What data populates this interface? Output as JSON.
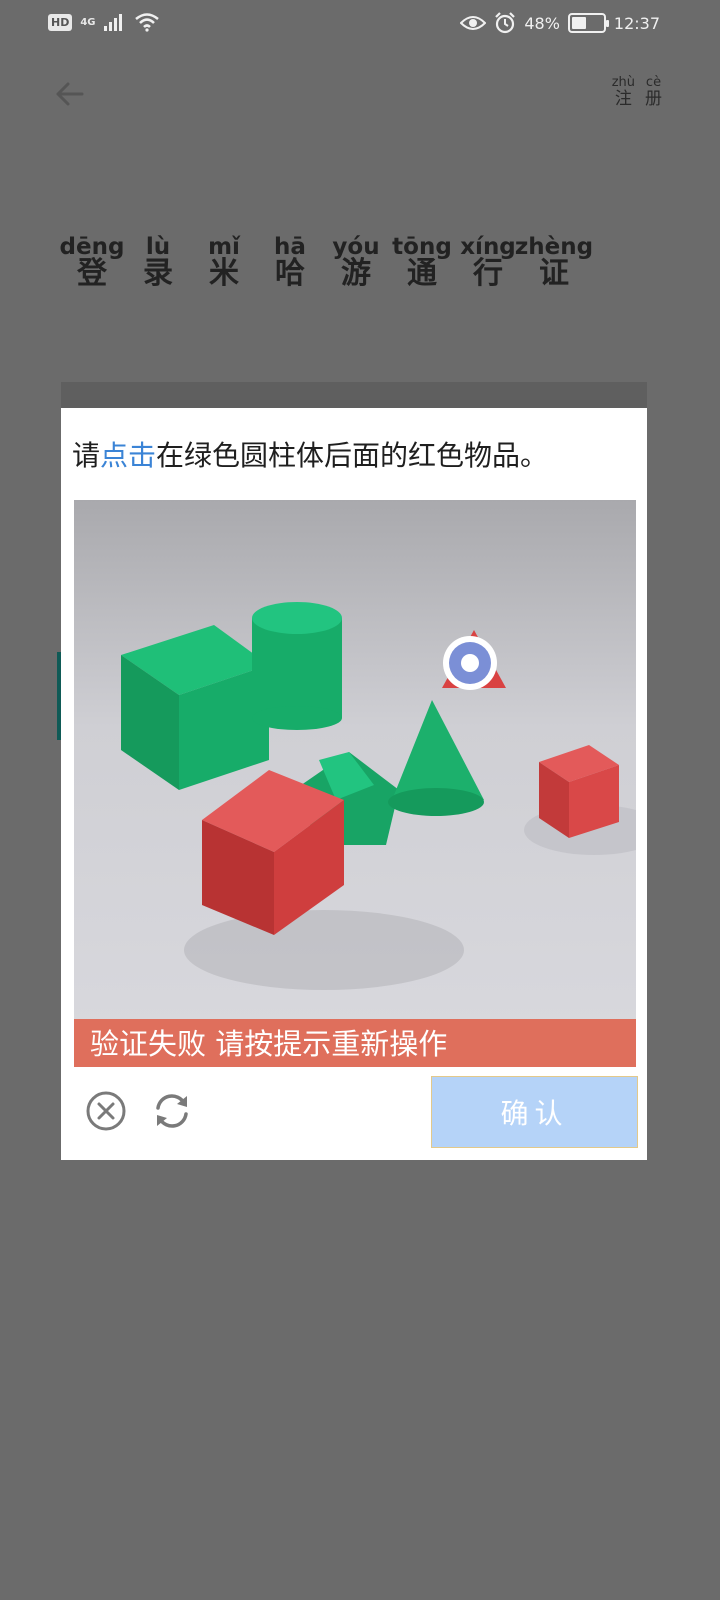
{
  "status_bar": {
    "hd_badge": "HD",
    "network": "4G",
    "icons": [
      "signal-icon",
      "wifi-icon",
      "eye-icon",
      "alarm-icon"
    ],
    "battery_percent": "48%",
    "battery_level": 0.48,
    "time": "12:37"
  },
  "header": {
    "back_icon": "arrow-left-icon",
    "register": [
      {
        "pinyin": "zhù",
        "hanzi": "注"
      },
      {
        "pinyin": "cè",
        "hanzi": "册"
      }
    ]
  },
  "title": [
    {
      "pinyin": "dēng",
      "hanzi": "登"
    },
    {
      "pinyin": "lù",
      "hanzi": "录"
    },
    {
      "pinyin": "mǐ",
      "hanzi": "米"
    },
    {
      "pinyin": "hā",
      "hanzi": "哈"
    },
    {
      "pinyin": "yóu",
      "hanzi": "游"
    },
    {
      "pinyin": "tōng",
      "hanzi": "通"
    },
    {
      "pinyin": "xíng",
      "hanzi": "行"
    },
    {
      "pinyin": "zhèng",
      "hanzi": "证"
    }
  ],
  "captcha": {
    "instruction_prefix": "请",
    "instruction_highlight": "点击",
    "instruction_suffix": "在绿色圆柱体后面的红色物品。",
    "error_message": "验证失败 请按提示重新操作",
    "close_icon": "close-circle-icon",
    "refresh_icon": "refresh-icon",
    "confirm_label": "确认",
    "colors": {
      "highlight": "#3b84d6",
      "error": "#df6f5c",
      "confirm": "#b5d3f8",
      "green_objects": "#18a465",
      "red_objects": "#d94242"
    }
  }
}
